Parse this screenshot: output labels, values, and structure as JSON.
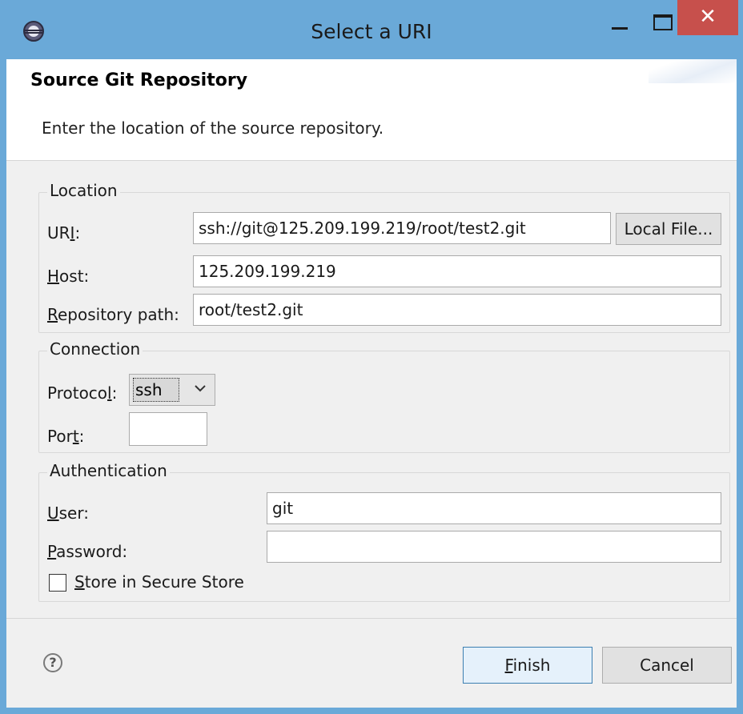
{
  "window": {
    "title": "Select a URI",
    "close_glyph": "✕"
  },
  "banner": {
    "title": "Source Git Repository",
    "description": "Enter the location of the source repository."
  },
  "location": {
    "group_label": "Location",
    "uri_label_pre": "UR",
    "uri_label_mn": "I",
    "uri_label_post": ":",
    "uri_value": "ssh://git@125.209.199.219/root/test2.git",
    "local_file_button": "Local File...",
    "host_label_mn": "H",
    "host_label_post": "ost:",
    "host_value": "125.209.199.219",
    "repo_label_mn": "R",
    "repo_label_post": "epository path:",
    "repo_value": "root/test2.git"
  },
  "connection": {
    "group_label": "Connection",
    "protocol_label_pre": "Protoco",
    "protocol_label_mn": "l",
    "protocol_label_post": ":",
    "protocol_value": "ssh",
    "port_label_pre": "Por",
    "port_label_mn": "t",
    "port_label_post": ":",
    "port_value": ""
  },
  "authentication": {
    "group_label": "Authentication",
    "user_label_mn": "U",
    "user_label_post": "ser:",
    "user_value": "git",
    "password_label_mn": "P",
    "password_label_post": "assword:",
    "password_value": "",
    "store_label_mn": "S",
    "store_label_post": "tore in Secure Store",
    "store_checked": false
  },
  "footer": {
    "help_glyph": "?",
    "finish_mn": "F",
    "finish_post": "inish",
    "cancel_label": "Cancel"
  },
  "colors": {
    "titlebar": "#6aa9d8",
    "close_button": "#c7504c",
    "dialog_bg": "#f0f0f0",
    "default_button_border": "#3c7fb1"
  },
  "icons": [
    "eclipse-app-icon",
    "minimize-icon",
    "maximize-icon",
    "close-icon",
    "chevron-down-icon",
    "help-icon"
  ]
}
